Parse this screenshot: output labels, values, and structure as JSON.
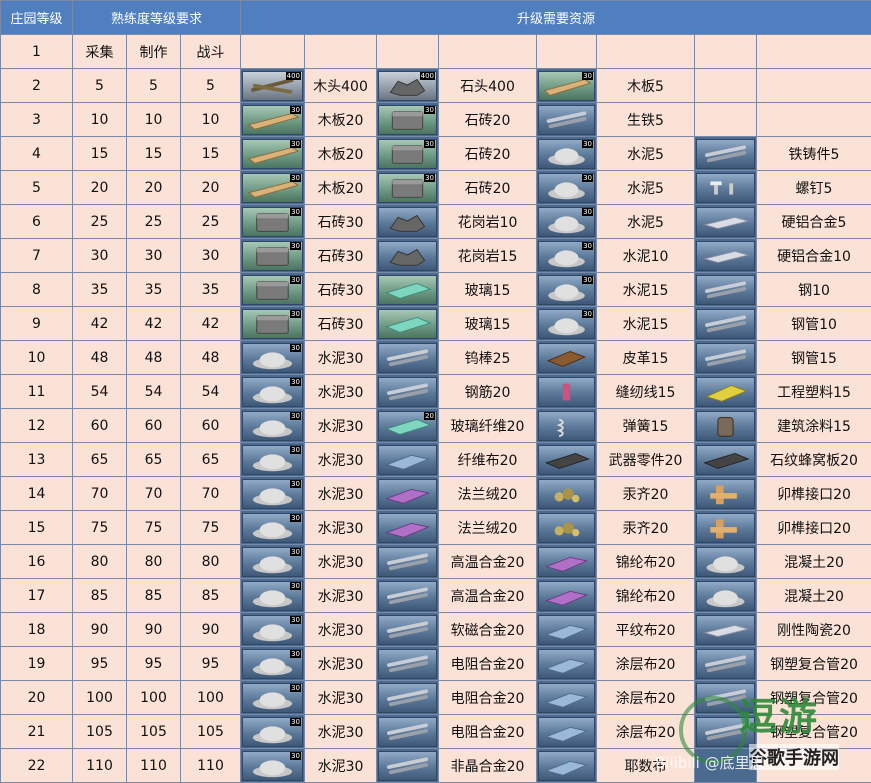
{
  "header": {
    "level": "庄园等级",
    "proficiency": "熟练度等级要求",
    "resources": "升级需要资源"
  },
  "subheader": {
    "level": "1",
    "gather": "采集",
    "craft": "制作",
    "combat": "战斗"
  },
  "rows": [
    {
      "level": "2",
      "gather": "5",
      "craft": "5",
      "combat": "5",
      "res": [
        {
          "name": "木头400",
          "icon": "wood-logs-icon",
          "qty": "400",
          "bg": "gray"
        },
        {
          "name": "石头400",
          "icon": "stone-icon",
          "qty": "400",
          "bg": "gray"
        },
        {
          "name": "木板5",
          "icon": "wood-plank-icon",
          "qty": "30",
          "bg": "green"
        },
        null
      ]
    },
    {
      "level": "3",
      "gather": "10",
      "craft": "10",
      "combat": "10",
      "res": [
        {
          "name": "木板20",
          "icon": "wood-plank-icon",
          "qty": "30",
          "bg": "green"
        },
        {
          "name": "石砖20",
          "icon": "stone-brick-icon",
          "qty": "30",
          "bg": "green"
        },
        {
          "name": "生铁5",
          "icon": "pig-iron-icon",
          "qty": "",
          "bg": "blue"
        },
        null
      ]
    },
    {
      "level": "4",
      "gather": "15",
      "craft": "15",
      "combat": "15",
      "res": [
        {
          "name": "木板20",
          "icon": "wood-plank-icon",
          "qty": "30",
          "bg": "green"
        },
        {
          "name": "石砖20",
          "icon": "stone-brick-icon",
          "qty": "30",
          "bg": "green"
        },
        {
          "name": "水泥5",
          "icon": "cement-icon",
          "qty": "30",
          "bg": "blue"
        },
        {
          "name": "铁铸件5",
          "icon": "iron-casting-icon",
          "qty": "",
          "bg": "blue"
        }
      ]
    },
    {
      "level": "5",
      "gather": "20",
      "craft": "20",
      "combat": "20",
      "res": [
        {
          "name": "木板20",
          "icon": "wood-plank-icon",
          "qty": "30",
          "bg": "green"
        },
        {
          "name": "石砖20",
          "icon": "stone-brick-icon",
          "qty": "30",
          "bg": "green"
        },
        {
          "name": "水泥5",
          "icon": "cement-icon",
          "qty": "30",
          "bg": "blue"
        },
        {
          "name": "螺钉5",
          "icon": "screw-icon",
          "qty": "",
          "bg": "blue"
        }
      ]
    },
    {
      "level": "6",
      "gather": "25",
      "craft": "25",
      "combat": "25",
      "res": [
        {
          "name": "石砖30",
          "icon": "stone-brick-icon",
          "qty": "30",
          "bg": "green"
        },
        {
          "name": "花岗岩10",
          "icon": "granite-icon",
          "qty": "",
          "bg": "blue"
        },
        {
          "name": "水泥5",
          "icon": "cement-icon",
          "qty": "30",
          "bg": "blue"
        },
        {
          "name": "硬铝合金5",
          "icon": "duralumin-icon",
          "qty": "",
          "bg": "blue"
        }
      ]
    },
    {
      "level": "7",
      "gather": "30",
      "craft": "30",
      "combat": "30",
      "res": [
        {
          "name": "石砖30",
          "icon": "stone-brick-icon",
          "qty": "30",
          "bg": "green"
        },
        {
          "name": "花岗岩15",
          "icon": "granite-icon",
          "qty": "",
          "bg": "blue"
        },
        {
          "name": "水泥10",
          "icon": "cement-icon",
          "qty": "30",
          "bg": "blue"
        },
        {
          "name": "硬铝合金10",
          "icon": "duralumin-icon",
          "qty": "",
          "bg": "blue"
        }
      ]
    },
    {
      "level": "8",
      "gather": "35",
      "craft": "35",
      "combat": "35",
      "res": [
        {
          "name": "石砖30",
          "icon": "stone-brick-icon",
          "qty": "30",
          "bg": "green"
        },
        {
          "name": "玻璃15",
          "icon": "glass-icon",
          "qty": "",
          "bg": "green"
        },
        {
          "name": "水泥15",
          "icon": "cement-icon",
          "qty": "30",
          "bg": "blue"
        },
        {
          "name": "钢10",
          "icon": "steel-icon",
          "qty": "",
          "bg": "blue"
        }
      ]
    },
    {
      "level": "9",
      "gather": "42",
      "craft": "42",
      "combat": "42",
      "res": [
        {
          "name": "石砖30",
          "icon": "stone-brick-icon",
          "qty": "30",
          "bg": "green"
        },
        {
          "name": "玻璃15",
          "icon": "glass-icon",
          "qty": "",
          "bg": "green"
        },
        {
          "name": "水泥15",
          "icon": "cement-icon",
          "qty": "30",
          "bg": "blue"
        },
        {
          "name": "钢管10",
          "icon": "steel-pipe-icon",
          "qty": "",
          "bg": "blue"
        }
      ]
    },
    {
      "level": "10",
      "gather": "48",
      "craft": "48",
      "combat": "48",
      "res": [
        {
          "name": "水泥30",
          "icon": "cement-icon",
          "qty": "30",
          "bg": "blue"
        },
        {
          "name": "钨棒25",
          "icon": "tungsten-rod-icon",
          "qty": "",
          "bg": "blue"
        },
        {
          "name": "皮革15",
          "icon": "leather-icon",
          "qty": "",
          "bg": "blue"
        },
        {
          "name": "钢管15",
          "icon": "steel-pipe-icon",
          "qty": "",
          "bg": "blue"
        }
      ]
    },
    {
      "level": "11",
      "gather": "54",
      "craft": "54",
      "combat": "54",
      "res": [
        {
          "name": "水泥30",
          "icon": "cement-icon",
          "qty": "30",
          "bg": "blue"
        },
        {
          "name": "钢筋20",
          "icon": "rebar-icon",
          "qty": "",
          "bg": "blue"
        },
        {
          "name": "缝纫线15",
          "icon": "thread-icon",
          "qty": "",
          "bg": "blue"
        },
        {
          "name": "工程塑料15",
          "icon": "plastic-icon",
          "qty": "",
          "bg": "blue"
        }
      ]
    },
    {
      "level": "12",
      "gather": "60",
      "craft": "60",
      "combat": "60",
      "res": [
        {
          "name": "水泥30",
          "icon": "cement-icon",
          "qty": "30",
          "bg": "blue"
        },
        {
          "name": "玻璃纤维20",
          "icon": "fiberglass-icon",
          "qty": "20",
          "bg": "blue"
        },
        {
          "name": "弹簧15",
          "icon": "spring-icon",
          "qty": "",
          "bg": "blue"
        },
        {
          "name": "建筑涂料15",
          "icon": "paint-can-icon",
          "qty": "",
          "bg": "blue"
        }
      ]
    },
    {
      "level": "13",
      "gather": "65",
      "craft": "65",
      "combat": "65",
      "res": [
        {
          "name": "水泥30",
          "icon": "cement-icon",
          "qty": "30",
          "bg": "blue"
        },
        {
          "name": "纤维布20",
          "icon": "fiber-cloth-icon",
          "qty": "",
          "bg": "blue"
        },
        {
          "name": "武器零件20",
          "icon": "weapon-part-icon",
          "qty": "",
          "bg": "blue"
        },
        {
          "name": "石纹蜂窝板20",
          "icon": "honeycomb-panel-icon",
          "qty": "",
          "bg": "blue"
        }
      ]
    },
    {
      "level": "14",
      "gather": "70",
      "craft": "70",
      "combat": "70",
      "res": [
        {
          "name": "水泥30",
          "icon": "cement-icon",
          "qty": "30",
          "bg": "blue"
        },
        {
          "name": "法兰绒20",
          "icon": "flannel-icon",
          "qty": "",
          "bg": "blue"
        },
        {
          "name": "汞齐20",
          "icon": "amalgam-icon",
          "qty": "",
          "bg": "blue"
        },
        {
          "name": "卯榫接口20",
          "icon": "mortise-joint-icon",
          "qty": "",
          "bg": "blue"
        }
      ]
    },
    {
      "level": "15",
      "gather": "75",
      "craft": "75",
      "combat": "75",
      "res": [
        {
          "name": "水泥30",
          "icon": "cement-icon",
          "qty": "30",
          "bg": "blue"
        },
        {
          "name": "法兰绒20",
          "icon": "flannel-icon",
          "qty": "",
          "bg": "blue"
        },
        {
          "name": "汞齐20",
          "icon": "amalgam-icon",
          "qty": "",
          "bg": "blue"
        },
        {
          "name": "卯榫接口20",
          "icon": "mortise-joint-icon",
          "qty": "",
          "bg": "blue"
        }
      ]
    },
    {
      "level": "16",
      "gather": "80",
      "craft": "80",
      "combat": "80",
      "res": [
        {
          "name": "水泥30",
          "icon": "cement-icon",
          "qty": "30",
          "bg": "blue"
        },
        {
          "name": "高温合金20",
          "icon": "superalloy-icon",
          "qty": "",
          "bg": "blue"
        },
        {
          "name": "锦纶布20",
          "icon": "nylon-cloth-icon",
          "qty": "",
          "bg": "blue"
        },
        {
          "name": "混凝土20",
          "icon": "concrete-icon",
          "qty": "",
          "bg": "blue"
        }
      ]
    },
    {
      "level": "17",
      "gather": "85",
      "craft": "85",
      "combat": "85",
      "res": [
        {
          "name": "水泥30",
          "icon": "cement-icon",
          "qty": "30",
          "bg": "blue"
        },
        {
          "name": "高温合金20",
          "icon": "superalloy-icon",
          "qty": "",
          "bg": "blue"
        },
        {
          "name": "锦纶布20",
          "icon": "nylon-cloth-icon",
          "qty": "",
          "bg": "blue"
        },
        {
          "name": "混凝土20",
          "icon": "concrete-icon",
          "qty": "",
          "bg": "blue"
        }
      ]
    },
    {
      "level": "18",
      "gather": "90",
      "craft": "90",
      "combat": "90",
      "res": [
        {
          "name": "水泥30",
          "icon": "cement-icon",
          "qty": "30",
          "bg": "blue"
        },
        {
          "name": "软磁合金20",
          "icon": "soft-magnetic-alloy-icon",
          "qty": "",
          "bg": "blue"
        },
        {
          "name": "平纹布20",
          "icon": "plain-cloth-icon",
          "qty": "",
          "bg": "blue"
        },
        {
          "name": "刚性陶瓷20",
          "icon": "ceramic-icon",
          "qty": "",
          "bg": "blue"
        }
      ]
    },
    {
      "level": "19",
      "gather": "95",
      "craft": "95",
      "combat": "95",
      "res": [
        {
          "name": "水泥30",
          "icon": "cement-icon",
          "qty": "30",
          "bg": "blue"
        },
        {
          "name": "电阻合金20",
          "icon": "resistance-alloy-icon",
          "qty": "",
          "bg": "blue"
        },
        {
          "name": "涂层布20",
          "icon": "coated-cloth-icon",
          "qty": "",
          "bg": "blue"
        },
        {
          "name": "钢塑复合管20",
          "icon": "composite-pipe-icon",
          "qty": "",
          "bg": "blue"
        }
      ]
    },
    {
      "level": "20",
      "gather": "100",
      "craft": "100",
      "combat": "100",
      "res": [
        {
          "name": "水泥30",
          "icon": "cement-icon",
          "qty": "30",
          "bg": "blue"
        },
        {
          "name": "电阻合金20",
          "icon": "resistance-alloy-icon",
          "qty": "",
          "bg": "blue"
        },
        {
          "name": "涂层布20",
          "icon": "coated-cloth-icon",
          "qty": "",
          "bg": "blue"
        },
        {
          "name": "钢塑复合管20",
          "icon": "composite-pipe-icon",
          "qty": "",
          "bg": "blue"
        }
      ]
    },
    {
      "level": "21",
      "gather": "105",
      "craft": "105",
      "combat": "105",
      "res": [
        {
          "name": "水泥30",
          "icon": "cement-icon",
          "qty": "30",
          "bg": "blue"
        },
        {
          "name": "电阻合金20",
          "icon": "resistance-alloy-icon",
          "qty": "",
          "bg": "blue"
        },
        {
          "name": "涂层布20",
          "icon": "coated-cloth-icon",
          "qty": "",
          "bg": "blue"
        },
        {
          "name": "钢塑复合管20",
          "icon": "composite-pipe-icon",
          "qty": "",
          "bg": "blue"
        }
      ]
    },
    {
      "level": "22",
      "gather": "110",
      "craft": "110",
      "combat": "110",
      "res": [
        {
          "name": "水泥30",
          "icon": "cement-icon",
          "qty": "30",
          "bg": "blue"
        },
        {
          "name": "非晶合金20",
          "icon": "amorphous-alloy-icon",
          "qty": "",
          "bg": "blue"
        },
        {
          "name": "耶数布",
          "icon": "cloth-roll-icon",
          "qty": "",
          "bg": "blue"
        },
        {
          "name": "",
          "icon": "",
          "qty": "",
          "bg": "blue"
        }
      ]
    }
  ],
  "watermark": {
    "brand": "逗游",
    "sub": "谷歌手游网",
    "overlay": "Bilibili @底里思"
  },
  "colors": {
    "header_bg": "#4f7fbf",
    "cell_bg": "#fbe2d6",
    "icon_bg": "#4a6a90",
    "grid": "#7a8aa6"
  }
}
